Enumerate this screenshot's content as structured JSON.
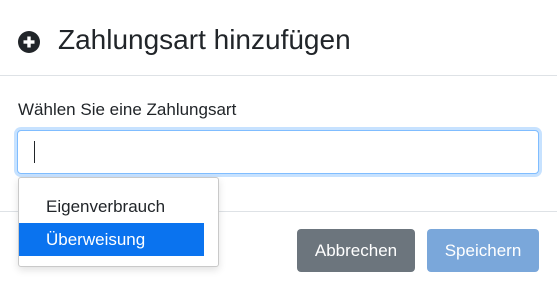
{
  "dialog": {
    "title": "Zahlungsart hinzufügen",
    "icon": "plus-circle-icon"
  },
  "form": {
    "label": "Wählen Sie eine Zahlungsart",
    "value": "",
    "options": [
      {
        "label": "Eigenverbrauch",
        "selected": false
      },
      {
        "label": "Überweisung",
        "selected": true
      }
    ]
  },
  "footer": {
    "cancel_label": "Abbrechen",
    "save_label": "Speichern"
  },
  "colors": {
    "primary": "#0a73ef",
    "cancel": "#6c757d",
    "save_disabled": "#7aa7da"
  }
}
